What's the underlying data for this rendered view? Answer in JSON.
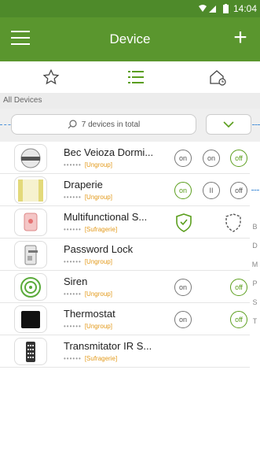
{
  "status_bar": {
    "time": "14:04"
  },
  "header": {
    "title": "Device",
    "add_label": "+"
  },
  "tabs": [
    {
      "name": "favorites",
      "icon": "star-icon"
    },
    {
      "name": "list",
      "icon": "list-icon"
    },
    {
      "name": "rooms",
      "icon": "home-clock-icon"
    }
  ],
  "section_label": "All Devices",
  "search": {
    "text": "7 devices in total"
  },
  "devices": [
    {
      "name": "Bec Veioza Dormi...",
      "dots": "••••••",
      "group": "[Ungroup]",
      "controls": [
        "on",
        "on",
        "off"
      ],
      "active": [
        false,
        false,
        true
      ]
    },
    {
      "name": "Draperie",
      "dots": "••••••",
      "group": "[Ungroup]",
      "controls": [
        "on",
        "II",
        "off"
      ],
      "active": [
        true,
        false,
        false
      ]
    },
    {
      "name": "Multifunctional S...",
      "dots": "••••••",
      "group": "[Sufragerie]"
    },
    {
      "name": "Password Lock",
      "dots": "••••••",
      "group": "[Ungroup]"
    },
    {
      "name": "Siren",
      "dots": "••••••",
      "group": "[Ungroup]",
      "controls": [
        "on",
        "off"
      ],
      "active": [
        false,
        true
      ]
    },
    {
      "name": "Thermostat",
      "dots": "••••••",
      "group": "[Ungroup]",
      "controls": [
        "on",
        "off"
      ],
      "active": [
        false,
        true
      ]
    },
    {
      "name": "Transmitator IR S...",
      "dots": "••••••",
      "group": "[Sufragerie]"
    }
  ],
  "index_letters": [
    "B",
    "D",
    "M",
    "P",
    "S",
    "T"
  ],
  "colors": {
    "header": "#5a962e",
    "accent": "#5a9e1c",
    "group_text": "#e39a1b"
  }
}
